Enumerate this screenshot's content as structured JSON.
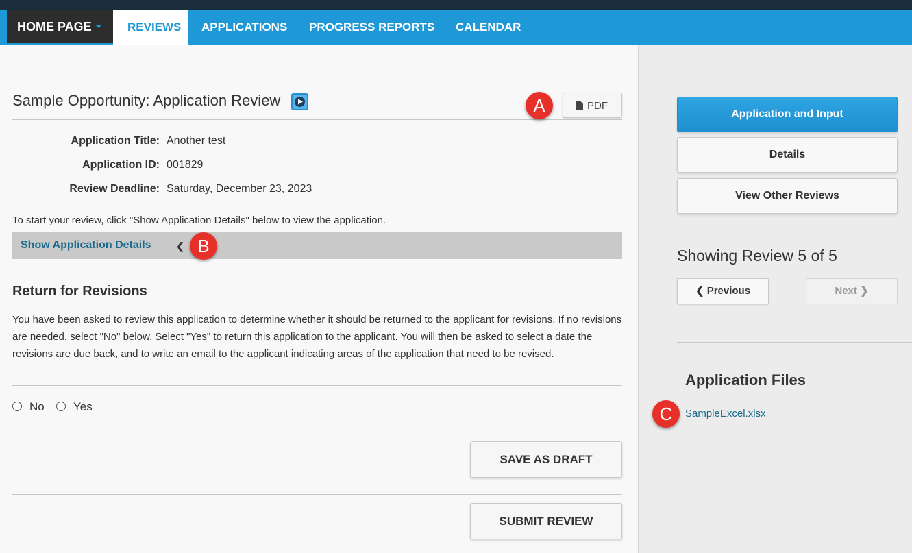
{
  "nav": {
    "home": "HOME PAGE",
    "active": "REVIEWS",
    "items": [
      "APPLICATIONS",
      "PROGRESS REPORTS",
      "CALENDAR"
    ]
  },
  "review": {
    "title": "Sample Opportunity: Application Review",
    "pdf_label": "PDF",
    "fields": [
      {
        "label": "Application Title:",
        "value": "Another test"
      },
      {
        "label": "Application ID:",
        "value": "001829"
      },
      {
        "label": "Review Deadline:",
        "value": "Saturday, December 23, 2023"
      }
    ],
    "intro": "To start your review, click \"Show Application Details\" below to view the application.",
    "show_details": "Show Application Details",
    "revisions_heading": "Return for Revisions",
    "revisions_text": "You have been asked to review this application to determine whether it should be returned to the applicant for revisions. If no revisions are needed, select \"No\" below. Select \"Yes\" to return this application to the applicant. You will then be asked to select a date the revisions are due back, and to write an email to the applicant indicating areas of the application that need to be revised.",
    "radio_no": "No",
    "radio_yes": "Yes",
    "save_draft": "SAVE AS DRAFT",
    "submit": "SUBMIT REVIEW"
  },
  "annotations": {
    "a": "A",
    "b": "B",
    "c": "C"
  },
  "sidebar": {
    "buttons": [
      "Application and Input",
      "Details",
      "View Other Reviews"
    ],
    "showing": "Showing Review 5 of 5",
    "previous": "Previous",
    "next": "Next",
    "files_heading": "Application Files",
    "file": "SampleExcel.xlsx"
  },
  "colors": {
    "nav_blue": "#1e98d6",
    "badge_red": "#e8302a",
    "link": "#1a6a8c"
  }
}
